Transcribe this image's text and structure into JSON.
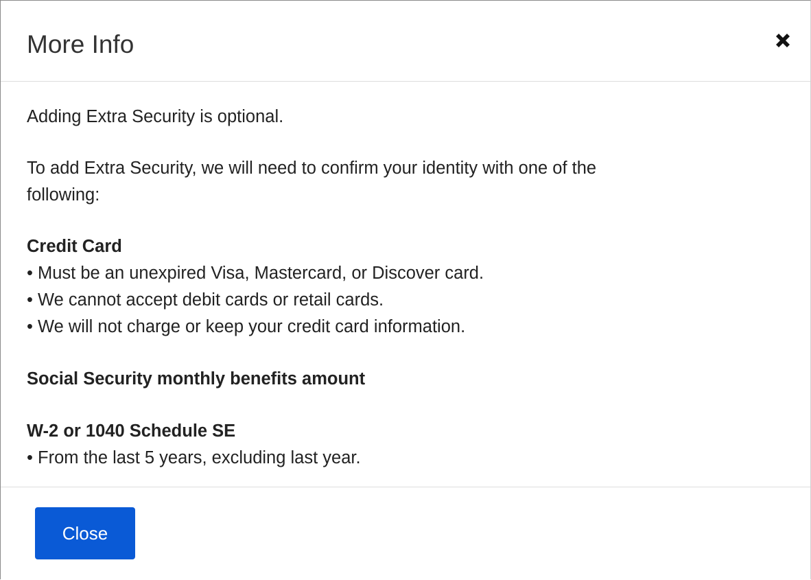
{
  "modal": {
    "title": "More Info",
    "close_icon": "close-x-icon",
    "body": {
      "intro": "Adding Extra Security is optional.",
      "lead_line1": "To add Extra Security, we will need to confirm your identity with one of the",
      "lead_line2": "following:",
      "credit_card": {
        "heading": "Credit Card",
        "bullets": [
          "• Must be an unexpired Visa, Mastercard, or Discover card.",
          "• We cannot accept debit cards or retail cards.",
          "• We will not charge or keep your credit card information."
        ]
      },
      "social_security": {
        "heading": "Social Security monthly benefits amount"
      },
      "w2": {
        "heading": "W-2 or 1040 Schedule SE",
        "bullets": [
          "• From the last 5 years, excluding last year."
        ]
      }
    },
    "footer": {
      "close_label": "Close"
    }
  },
  "colors": {
    "primary_button": "#0a5ad6",
    "text": "#333333",
    "divider": "#dddddd"
  }
}
